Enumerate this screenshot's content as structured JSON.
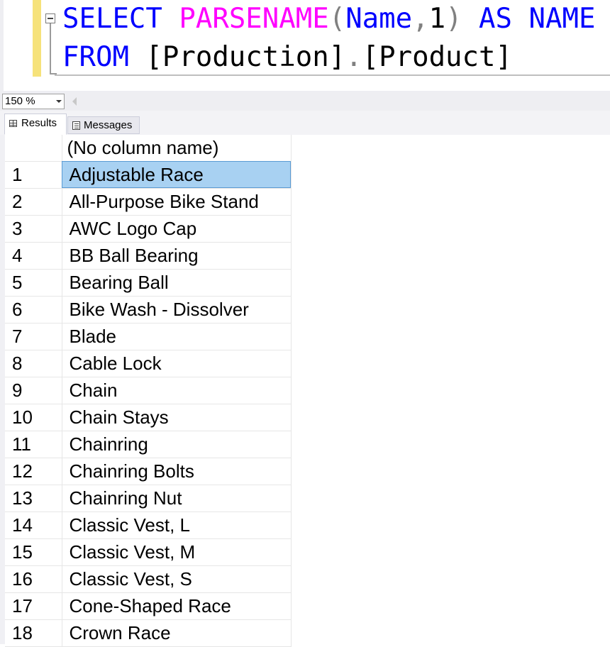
{
  "editor": {
    "line1": {
      "kw_select": "SELECT",
      "fn_parsename": "PARSENAME",
      "paren_open": "(",
      "arg_name": "Name",
      "comma": ",",
      "arg_num": "1",
      "paren_close": ")",
      "kw_as": "AS",
      "alias": "NAME"
    },
    "line2": {
      "kw_from": "FROM",
      "schema": "[Production]",
      "dot": ".",
      "table": "[Product]"
    }
  },
  "zoom": {
    "value": "150 %"
  },
  "tabs": {
    "results": "Results",
    "messages": "Messages"
  },
  "grid": {
    "header": "(No column name)",
    "rows": [
      {
        "n": "1",
        "v": "Adjustable Race"
      },
      {
        "n": "2",
        "v": "All-Purpose Bike Stand"
      },
      {
        "n": "3",
        "v": "AWC Logo Cap"
      },
      {
        "n": "4",
        "v": "BB Ball Bearing"
      },
      {
        "n": "5",
        "v": "Bearing Ball"
      },
      {
        "n": "6",
        "v": "Bike Wash - Dissolver"
      },
      {
        "n": "7",
        "v": "Blade"
      },
      {
        "n": "8",
        "v": "Cable Lock"
      },
      {
        "n": "9",
        "v": "Chain"
      },
      {
        "n": "10",
        "v": "Chain Stays"
      },
      {
        "n": "11",
        "v": "Chainring"
      },
      {
        "n": "12",
        "v": "Chainring Bolts"
      },
      {
        "n": "13",
        "v": "Chainring Nut"
      },
      {
        "n": "14",
        "v": "Classic Vest, L"
      },
      {
        "n": "15",
        "v": "Classic Vest, M"
      },
      {
        "n": "16",
        "v": "Classic Vest, S"
      },
      {
        "n": "17",
        "v": "Cone-Shaped Race"
      },
      {
        "n": "18",
        "v": "Crown Race"
      }
    ]
  },
  "colors": {
    "keyword": "#0000ff",
    "function": "#ff00ff",
    "operator": "#808080",
    "selection": "#a8d1f2",
    "change_bar": "#f6e27a"
  }
}
